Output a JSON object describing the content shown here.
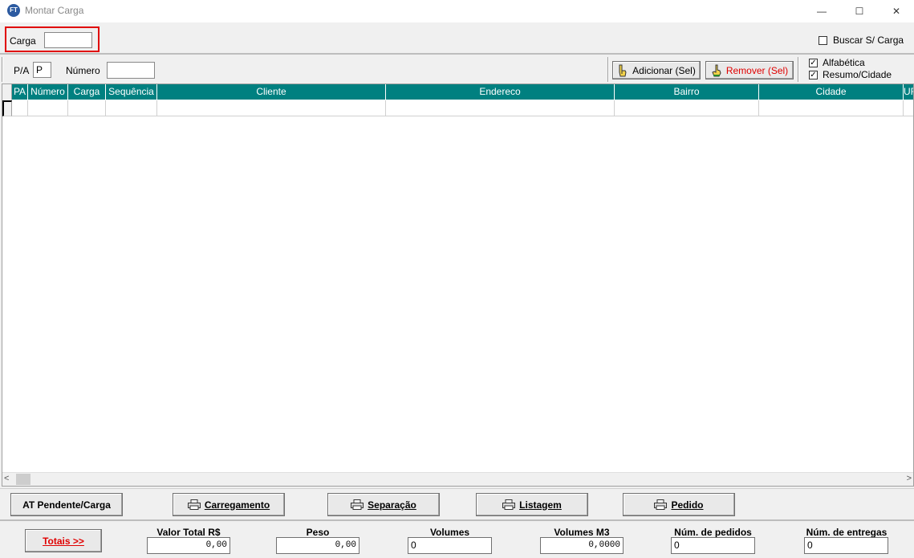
{
  "window": {
    "icon_text": "FT",
    "title": "Montar Carga",
    "minimize_glyph": "—",
    "maximize_glyph": "☐",
    "close_glyph": "✕"
  },
  "top": {
    "carga_label": "Carga",
    "carga_value": "",
    "buscar_label": "Buscar S/ Carga",
    "buscar_checked": false
  },
  "filter": {
    "pa_label": "P/A",
    "pa_value": "P",
    "numero_label": "Número",
    "numero_value": "",
    "adicionar_label": "Adicionar (Sel)",
    "remover_label": "Remover (Sel)",
    "alfabetica_label": "Alfabética",
    "alfabetica_checked": true,
    "resumo_label": "Resumo/Cidade",
    "resumo_checked": true
  },
  "grid": {
    "columns": [
      "PA",
      "Número",
      "Carga",
      "Sequência",
      "Cliente",
      "Endereco",
      "Bairro",
      "Cidade",
      "UF"
    ],
    "scroll_left": "<",
    "scroll_right": ">"
  },
  "actions": {
    "at_pendente": "AT Pendente/Carga",
    "carregamento": "Carregamento",
    "separacao": "Separação",
    "listagem": "Listagem",
    "pedido": "Pedido"
  },
  "totals": {
    "button": "Totais  >>",
    "valor_total_label": "Valor Total R$",
    "valor_total_value": "0,00",
    "peso_label": "Peso",
    "peso_value": "0,00",
    "volumes_label": "Volumes",
    "volumes_value": "0",
    "volumes_m3_label": "Volumes M3",
    "volumes_m3_value": "0,0000",
    "num_pedidos_label": "Núm. de pedidos",
    "num_pedidos_value": "0",
    "num_entregas_label": "Núm. de entregas",
    "num_entregas_value": "0"
  },
  "colors": {
    "header_teal": "#008080",
    "highlight_red": "#e00000"
  }
}
